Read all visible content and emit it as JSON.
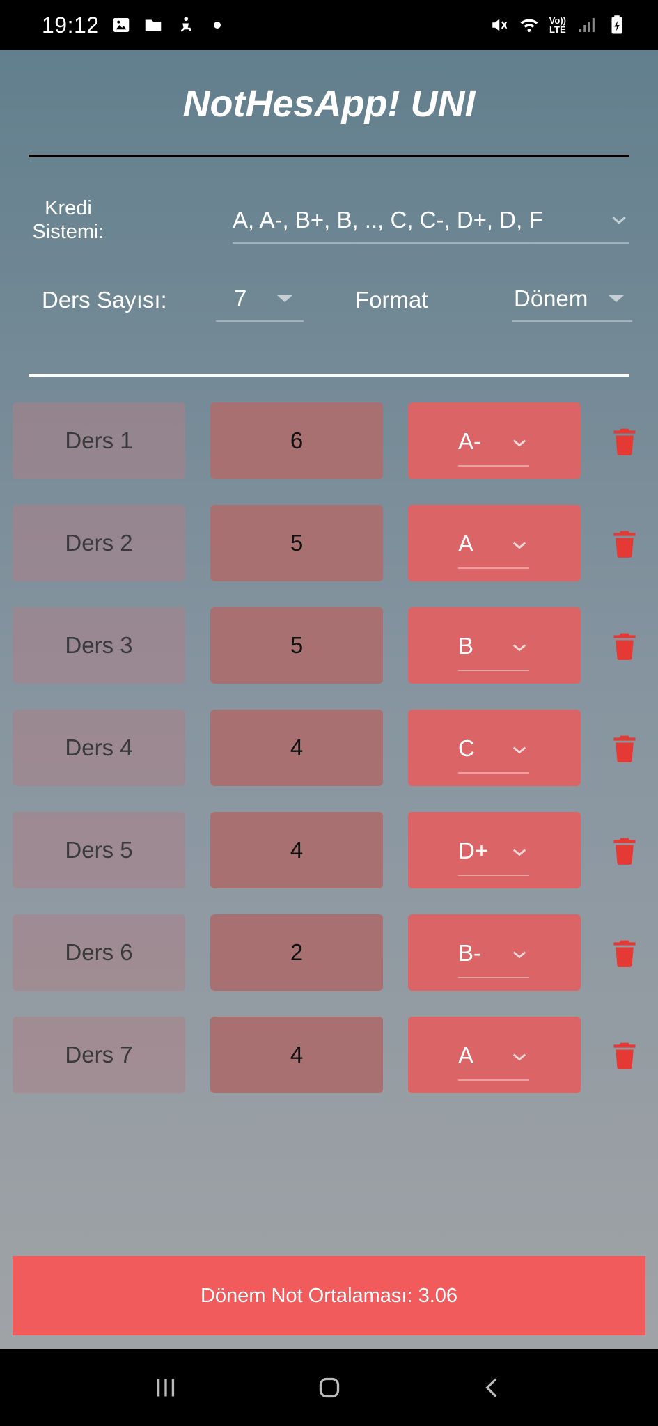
{
  "status_bar": {
    "time": "19:12",
    "left_icons": [
      "image-icon",
      "folder-icon",
      "accessibility-icon",
      "dot-icon"
    ],
    "right_icons": [
      "mute-icon",
      "wifi-icon",
      "volte-icon",
      "signal-icon",
      "battery-icon"
    ],
    "volte_top": "Vo))",
    "volte_bottom": "LTE"
  },
  "app": {
    "title": "NotHesApp! UNI",
    "kredi_label": "Kredi Sistemi:",
    "kredi_value": "A, A-, B+, B, .., C, C-, D+, D, F",
    "ders_sayisi_label": "Ders Sayısı:",
    "ders_sayisi_value": "7",
    "format_label": "Format",
    "format_value": "Dönem"
  },
  "courses": [
    {
      "name": "Ders 1",
      "credit": "6",
      "grade": "A-"
    },
    {
      "name": "Ders 2",
      "credit": "5",
      "grade": "A"
    },
    {
      "name": "Ders 3",
      "credit": "5",
      "grade": "B"
    },
    {
      "name": "Ders 4",
      "credit": "4",
      "grade": "C"
    },
    {
      "name": "Ders 5",
      "credit": "4",
      "grade": "D+"
    },
    {
      "name": "Ders 6",
      "credit": "2",
      "grade": "B-"
    },
    {
      "name": "Ders 7",
      "credit": "4",
      "grade": "A"
    }
  ],
  "average": {
    "text": "Dönem Not Ortalaması: 3.06"
  },
  "colors": {
    "accent_red": "#f25b5c",
    "grade_box": "#db6466",
    "credit_box": "#a87070",
    "trash_icon": "#e53935"
  },
  "nav": {
    "icons": [
      "recent-apps-icon",
      "home-icon",
      "back-icon"
    ]
  }
}
